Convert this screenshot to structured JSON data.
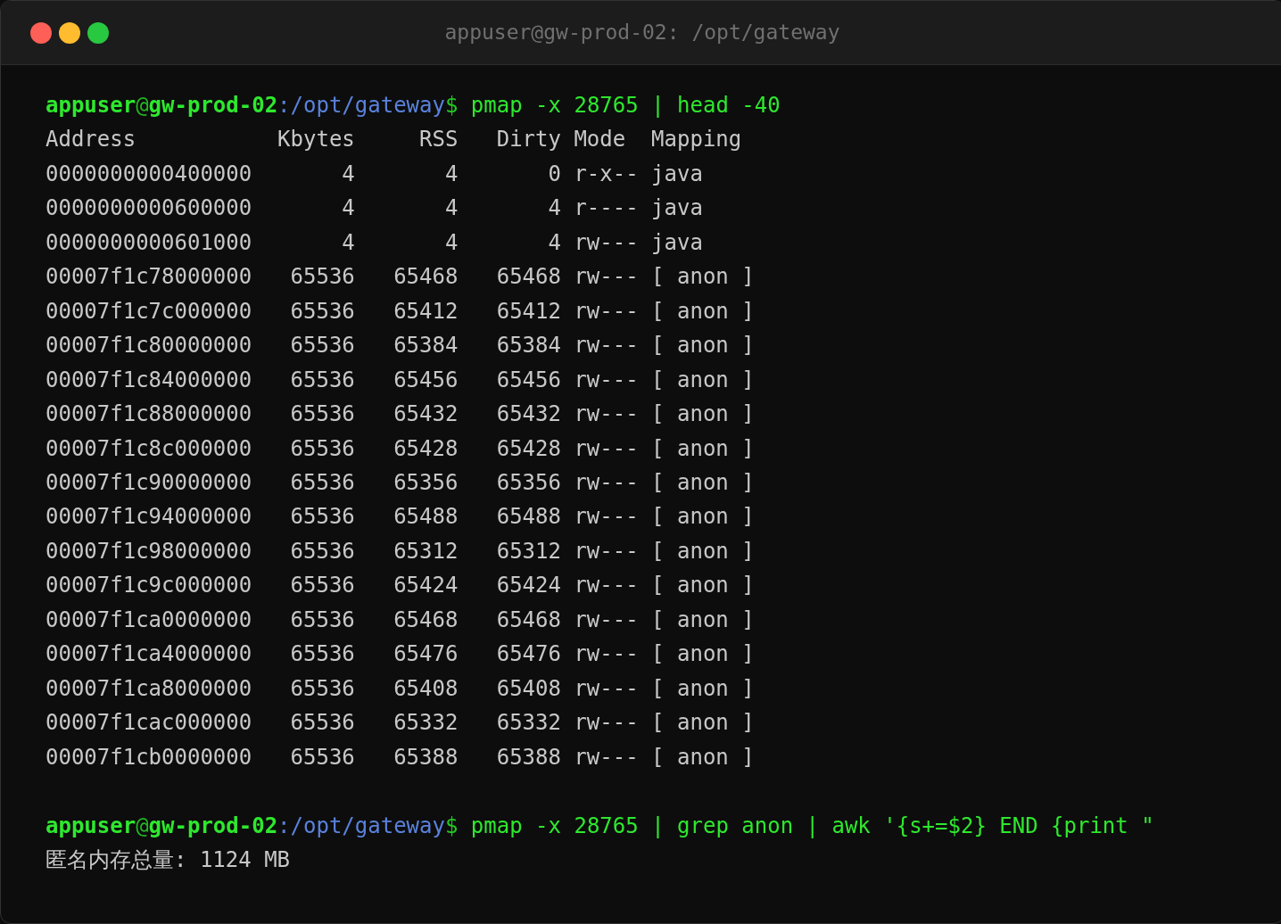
{
  "window": {
    "title": "appuser@gw-prod-02: /opt/gateway",
    "buttons": [
      {
        "kind": "close"
      },
      {
        "kind": "minimize"
      },
      {
        "kind": "zoom"
      }
    ]
  },
  "blocks": [
    {
      "prompt": [
        {
          "kind": "user",
          "text": "appuser"
        },
        {
          "kind": "at",
          "text": "@"
        },
        {
          "kind": "host",
          "text": "gw-prod-02"
        },
        {
          "kind": "colon",
          "text": ":"
        },
        {
          "kind": "path",
          "text": "/opt/gateway"
        },
        {
          "kind": "dollar",
          "text": "$"
        }
      ],
      "command": "pmap -x 28765 | head -40",
      "table": {
        "columns": [
          "Address",
          "Kbytes",
          "RSS",
          "Dirty",
          "Mode",
          "Mapping"
        ],
        "rows": [
          [
            "0000000000400000",
            "4",
            "4",
            "0",
            "r-x--",
            "java"
          ],
          [
            "0000000000600000",
            "4",
            "4",
            "4",
            "r----",
            "java"
          ],
          [
            "0000000000601000",
            "4",
            "4",
            "4",
            "rw---",
            "java"
          ],
          [
            "00007f1c78000000",
            "65536",
            "65468",
            "65468",
            "rw---",
            "[ anon ]"
          ],
          [
            "00007f1c7c000000",
            "65536",
            "65412",
            "65412",
            "rw---",
            "[ anon ]"
          ],
          [
            "00007f1c80000000",
            "65536",
            "65384",
            "65384",
            "rw---",
            "[ anon ]"
          ],
          [
            "00007f1c84000000",
            "65536",
            "65456",
            "65456",
            "rw---",
            "[ anon ]"
          ],
          [
            "00007f1c88000000",
            "65536",
            "65432",
            "65432",
            "rw---",
            "[ anon ]"
          ],
          [
            "00007f1c8c000000",
            "65536",
            "65428",
            "65428",
            "rw---",
            "[ anon ]"
          ],
          [
            "00007f1c90000000",
            "65536",
            "65356",
            "65356",
            "rw---",
            "[ anon ]"
          ],
          [
            "00007f1c94000000",
            "65536",
            "65488",
            "65488",
            "rw---",
            "[ anon ]"
          ],
          [
            "00007f1c98000000",
            "65536",
            "65312",
            "65312",
            "rw---",
            "[ anon ]"
          ],
          [
            "00007f1c9c000000",
            "65536",
            "65424",
            "65424",
            "rw---",
            "[ anon ]"
          ],
          [
            "00007f1ca0000000",
            "65536",
            "65468",
            "65468",
            "rw---",
            "[ anon ]"
          ],
          [
            "00007f1ca4000000",
            "65536",
            "65476",
            "65476",
            "rw---",
            "[ anon ]"
          ],
          [
            "00007f1ca8000000",
            "65536",
            "65408",
            "65408",
            "rw---",
            "[ anon ]"
          ],
          [
            "00007f1cac000000",
            "65536",
            "65332",
            "65332",
            "rw---",
            "[ anon ]"
          ],
          [
            "00007f1cb0000000",
            "65536",
            "65388",
            "65388",
            "rw---",
            "[ anon ]"
          ]
        ]
      }
    },
    {
      "prompt": [
        {
          "kind": "user",
          "text": "appuser"
        },
        {
          "kind": "at",
          "text": "@"
        },
        {
          "kind": "host",
          "text": "gw-prod-02"
        },
        {
          "kind": "colon",
          "text": ":"
        },
        {
          "kind": "path",
          "text": "/opt/gateway"
        },
        {
          "kind": "dollar",
          "text": "$"
        }
      ],
      "command": "pmap -x 28765 | grep anon | awk '{s+=$2} END {print \"",
      "output": [
        "匿名内存总量: 1124 MB"
      ]
    }
  ]
}
